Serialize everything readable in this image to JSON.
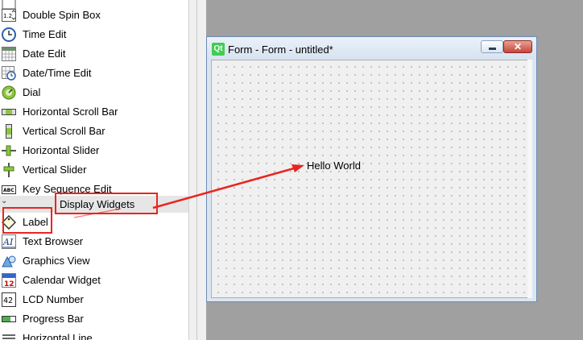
{
  "widget_box": {
    "items": [
      {
        "label": "",
        "icon": "spin-box-icon"
      },
      {
        "label": "Double Spin Box",
        "icon": "double-spin-box-icon"
      },
      {
        "label": "Time Edit",
        "icon": "clock-icon"
      },
      {
        "label": "Date Edit",
        "icon": "calendar-grid-icon"
      },
      {
        "label": "Date/Time Edit",
        "icon": "calendar-clock-icon"
      },
      {
        "label": "Dial",
        "icon": "dial-icon"
      },
      {
        "label": "Horizontal Scroll Bar",
        "icon": "horizontal-scrollbar-icon"
      },
      {
        "label": "Vertical Scroll Bar",
        "icon": "vertical-scrollbar-icon"
      },
      {
        "label": "Horizontal Slider",
        "icon": "horizontal-slider-icon"
      },
      {
        "label": "Vertical Slider",
        "icon": "vertical-slider-icon"
      },
      {
        "label": "Key Sequence Edit",
        "icon": "key-sequence-icon"
      }
    ],
    "category": "Display Widgets",
    "display_items": [
      {
        "label": "Label",
        "icon": "label-tag-icon"
      },
      {
        "label": "Text Browser",
        "icon": "text-browser-icon"
      },
      {
        "label": "Graphics View",
        "icon": "graphics-view-icon"
      },
      {
        "label": "Calendar Widget",
        "icon": "calendar-widget-icon"
      },
      {
        "label": "LCD Number",
        "icon": "lcd-number-icon"
      },
      {
        "label": "Progress Bar",
        "icon": "progress-bar-icon"
      },
      {
        "label": "Horizontal Line",
        "icon": "horizontal-line-icon"
      }
    ]
  },
  "form": {
    "logo": "Qt",
    "title": "Form - Form - untitled*",
    "label_text": "Hello World"
  },
  "icons": {
    "double_spin": "1.2",
    "calendar_day": "12",
    "lcd": "42",
    "key_seq": "ABC",
    "text_browser": "AI",
    "close": "✕"
  },
  "colors": {
    "annotation": "#e8251f",
    "qt_green": "#41cd52",
    "close_red": "#c7453a"
  }
}
